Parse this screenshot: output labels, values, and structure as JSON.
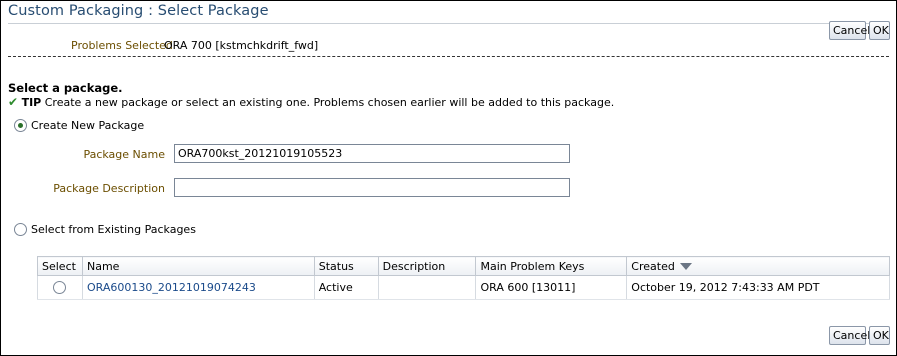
{
  "page": {
    "title": "Custom Packaging : Select Package",
    "cancel_label": "Cancel",
    "ok_label": "OK"
  },
  "problems": {
    "label": "Problems Selected",
    "value": "ORA 700 [kstmchkdrift_fwd]"
  },
  "section": {
    "heading": "Select a package.",
    "tip_label": "TIP",
    "tip_text": " Create a new package or select an existing one. Problems chosen earlier will be added to this package."
  },
  "create_option": {
    "label": "Create New Package",
    "selected": true,
    "package_name_label": "Package Name",
    "package_name_value": "ORA700kst_20121019105523",
    "package_description_label": "Package Description",
    "package_description_value": ""
  },
  "existing_option": {
    "label": "Select from Existing Packages",
    "selected": false
  },
  "table": {
    "columns": [
      "Select",
      "Name",
      "Status",
      "Description",
      "Main Problem Keys",
      "Created"
    ],
    "sorted_column": "Created",
    "sort_direction": "descending",
    "rows": [
      {
        "name": "ORA600130_20121019074243",
        "status": "Active",
        "description": "",
        "main_problem_keys": "ORA 600 [13011]",
        "created": "October 19, 2012 7:43:33 AM PDT"
      }
    ]
  },
  "colors": {
    "title": "#284d72",
    "field_label": "#6b4e00",
    "link": "#1a4a8a",
    "tip_check": "#2e8b2e"
  }
}
